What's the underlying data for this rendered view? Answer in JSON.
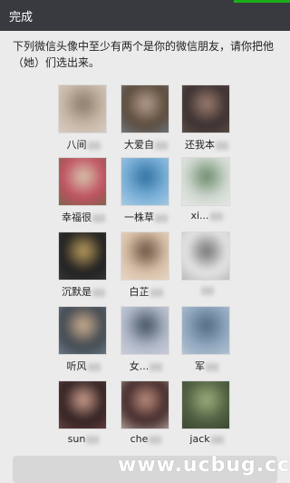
{
  "header": {
    "done_label": "完成"
  },
  "prompt_text": "下列微信头像中至少有两个是你的微信朋友，请你把他（她）们选出来。",
  "avatars": [
    {
      "name": "八间",
      "colors": [
        "#c8b8a8",
        "#8a7a6a",
        "#e0d6cc"
      ]
    },
    {
      "name": "大爱自",
      "colors": [
        "#5a4a3a",
        "#b8a090",
        "#7a8aa0"
      ]
    },
    {
      "name": "还我本",
      "colors": [
        "#3a3030",
        "#a08070",
        "#6a5a50"
      ]
    },
    {
      "name": "幸福很",
      "colors": [
        "#c05060",
        "#d8c8b0",
        "#5a7040"
      ]
    },
    {
      "name": "一株草",
      "colors": [
        "#7ab0d8",
        "#3070a0",
        "#c0d8e8"
      ]
    },
    {
      "name": "xi...",
      "colors": [
        "#d0d8d0",
        "#6a8a6a",
        "#f0f0f0"
      ]
    },
    {
      "name": "沉默是",
      "colors": [
        "#202020",
        "#c0a060",
        "#404040"
      ]
    },
    {
      "name": "白芷",
      "colors": [
        "#d8c0a8",
        "#6a5040",
        "#f0e0d0"
      ]
    },
    {
      "name": "",
      "colors": [
        "#e8e8e8",
        "#707070",
        "#a0a0a0"
      ]
    },
    {
      "name": "听风",
      "colors": [
        "#404850",
        "#d0b090",
        "#8090a0"
      ]
    },
    {
      "name": "女...",
      "colors": [
        "#b0b8c8",
        "#405060",
        "#d8d8e0"
      ]
    },
    {
      "name": "军",
      "colors": [
        "#90a8c0",
        "#506880",
        "#c8d0d8"
      ]
    },
    {
      "name": "sun",
      "colors": [
        "#302020",
        "#d0a090",
        "#805050"
      ]
    },
    {
      "name": "che",
      "colors": [
        "#402828",
        "#c09080",
        "#e0d0c8"
      ]
    },
    {
      "name": "jack",
      "colors": [
        "#506040",
        "#a0b080",
        "#303828"
      ]
    }
  ],
  "watermark": "www.ucbug.cc"
}
